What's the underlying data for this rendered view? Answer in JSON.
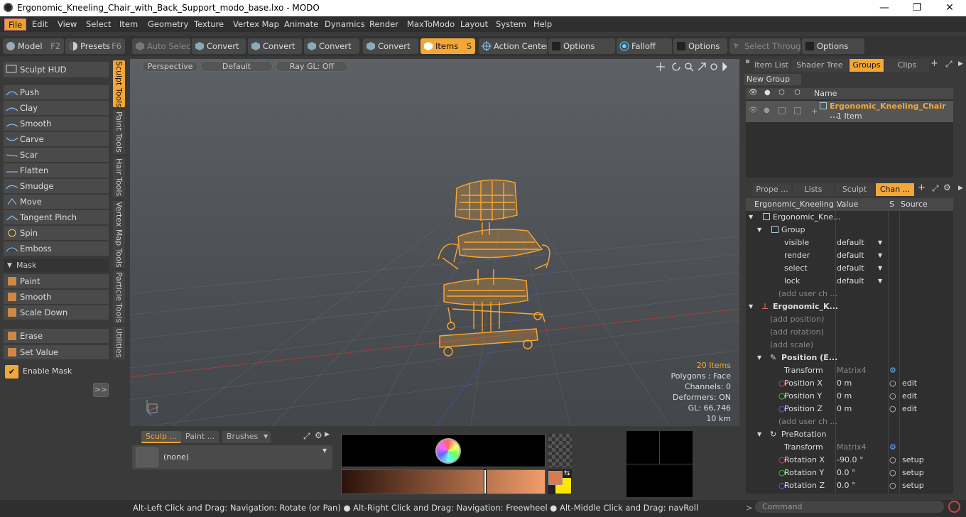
{
  "window": {
    "title": "Ergonomic_Kneeling_Chair_with_Back_Support_modo_base.lxo - MODO",
    "minimize": "—",
    "maximize": "❐",
    "close": "✕"
  },
  "menu": [
    "File",
    "Edit",
    "View",
    "Select",
    "Item",
    "Geometry",
    "Texture",
    "Vertex Map",
    "Animate",
    "Dynamics",
    "Render",
    "MaxToModo",
    "Layout",
    "System",
    "Help"
  ],
  "toolbar": {
    "model": "Model",
    "model_key": "F2",
    "presets": "Presets",
    "presets_key": "F6",
    "auto_select": "Auto Select",
    "convert1": "Convert",
    "convert2": "Convert",
    "convert3": "Convert",
    "convert4": "Convert",
    "items": "Items",
    "items_key": "S",
    "action_center": "Action Center",
    "options1": "Options",
    "falloff": "Falloff",
    "options2": "Options",
    "select_through": "Select Through",
    "options3": "Options"
  },
  "left": {
    "sculpt_hud": "Sculpt HUD",
    "tools": [
      "Push",
      "Clay",
      "Smooth",
      "Carve",
      "Scar",
      "Flatten",
      "Smudge",
      "Move",
      "Tangent Pinch",
      "Spin",
      "Emboss"
    ],
    "mask_header": "Mask",
    "mask_tools": [
      "Paint",
      "Smooth",
      "Scale Down"
    ],
    "erase": "Erase",
    "set_value": "Set Value",
    "enable_mask": "Enable Mask",
    "expand": ">>"
  },
  "vtabs": [
    "Sculpt Tools",
    "Paint Tools",
    "Hair Tools",
    "Vertex Map Tools",
    "Particle Tools",
    "Utilities"
  ],
  "viewport": {
    "perspective": "Perspective",
    "default": "Default",
    "raygl": "Ray GL: Off",
    "stats": {
      "items": "20 Items",
      "polygons": "Polygons : Face",
      "channels": "Channels: 0",
      "deformers": "Deformers: ON",
      "gl": "GL: 66,746",
      "dist": "10 km"
    }
  },
  "bottom": {
    "tabs": [
      "Sculp ...",
      "Paint ...",
      "Brushes"
    ],
    "preset": "(none)"
  },
  "right": {
    "top_tabs": [
      "Item List",
      "Shader Tree",
      "Groups",
      "Clips"
    ],
    "new_group": "New Group",
    "name_header": "Name",
    "group_name": "Ergonomic_Kneeling_Chair ...",
    "group_count": "1 Item",
    "mid_tabs": [
      "Prope ...",
      "Lists",
      "Sculpt",
      "Chan ..."
    ],
    "chan_headers": [
      "Ergonomic_Kneeling ...",
      "Value",
      "S",
      "Source"
    ],
    "rows": [
      {
        "label": "Ergonomic_Kne...",
        "value": "",
        "s": "",
        "src": ""
      },
      {
        "label": "Group",
        "value": "",
        "s": "",
        "src": ""
      },
      {
        "label": "visible",
        "value": "default",
        "s": "",
        "src": ""
      },
      {
        "label": "render",
        "value": "default",
        "s": "",
        "src": ""
      },
      {
        "label": "select",
        "value": "default",
        "s": "",
        "src": ""
      },
      {
        "label": "lock",
        "value": "default",
        "s": "",
        "src": ""
      },
      {
        "label": "(add user ch ...",
        "value": "",
        "s": "",
        "src": ""
      },
      {
        "label": "Ergonomic_K...",
        "value": "",
        "s": "",
        "src": ""
      },
      {
        "label": "(add position)",
        "value": "",
        "s": "",
        "src": ""
      },
      {
        "label": "(add rotation)",
        "value": "",
        "s": "",
        "src": ""
      },
      {
        "label": "(add scale)",
        "value": "",
        "s": "",
        "src": ""
      },
      {
        "label": "Position (E...",
        "value": "",
        "s": "",
        "src": ""
      },
      {
        "label": "Transform",
        "value": "Matrix4",
        "s": "",
        "src": ""
      },
      {
        "label": "Position X",
        "value": "0 m",
        "s": "",
        "src": "edit"
      },
      {
        "label": "Position Y",
        "value": "0 m",
        "s": "",
        "src": "edit"
      },
      {
        "label": "Position Z",
        "value": "0 m",
        "s": "",
        "src": "edit"
      },
      {
        "label": "(add user ch ...",
        "value": "",
        "s": "",
        "src": ""
      },
      {
        "label": "PreRotation",
        "value": "",
        "s": "",
        "src": ""
      },
      {
        "label": "Transform",
        "value": "Matrix4",
        "s": "",
        "src": ""
      },
      {
        "label": "Rotation X",
        "value": "-90.0 °",
        "s": "",
        "src": "setup"
      },
      {
        "label": "Rotation Y",
        "value": "0.0 °",
        "s": "",
        "src": "setup"
      },
      {
        "label": "Rotation Z",
        "value": "0.0 °",
        "s": "",
        "src": "setup"
      }
    ]
  },
  "status": "Alt-Left Click and Drag: Navigation: Rotate (or Pan) ● Alt-Right Click and Drag: Navigation: Freewheel ● Alt-Middle Click and Drag: navRoll",
  "command_placeholder": "Command",
  "colors": {
    "accent": "#f3a737",
    "wire": "#ffa62b"
  }
}
